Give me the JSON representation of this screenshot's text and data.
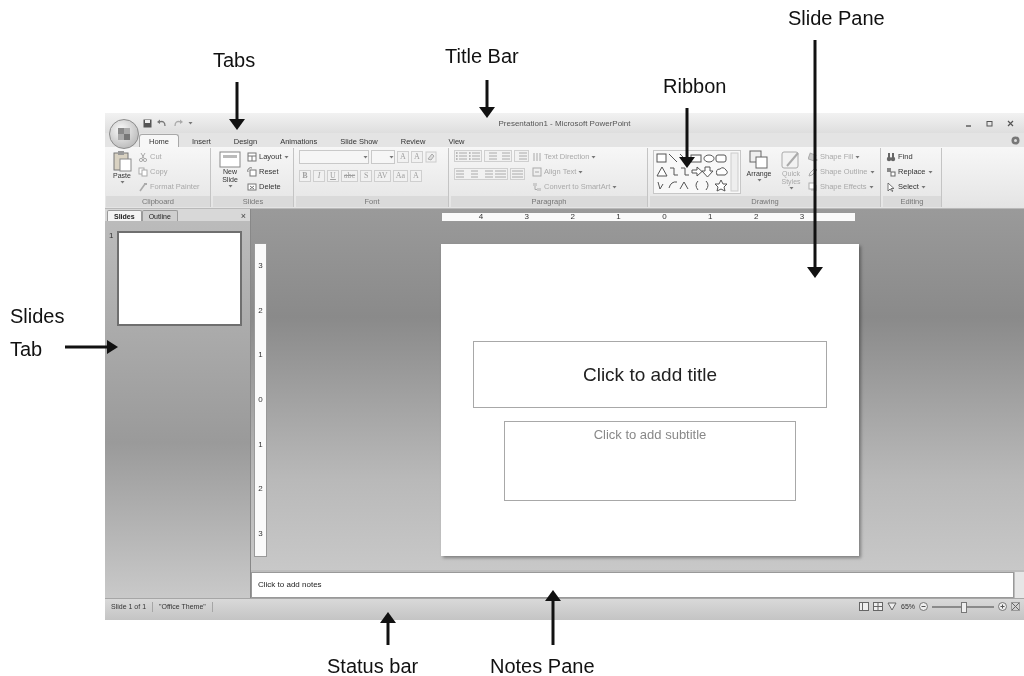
{
  "annotations": [
    {
      "text": "Slide Pane"
    },
    {
      "text": "Tabs"
    },
    {
      "text": "Title Bar"
    },
    {
      "text": "Ribbon"
    },
    {
      "text": "Slides Tab"
    },
    {
      "text": "Status bar"
    },
    {
      "text": "Notes Pane"
    }
  ],
  "title_bar": {
    "title": "Presentation1 - Microsoft PowerPoint"
  },
  "tabs": [
    {
      "label": "Home",
      "selected": true
    },
    {
      "label": "Insert",
      "selected": false
    },
    {
      "label": "Design",
      "selected": false
    },
    {
      "label": "Animations",
      "selected": false
    },
    {
      "label": "Slide Show",
      "selected": false
    },
    {
      "label": "Review",
      "selected": false
    },
    {
      "label": "View",
      "selected": false
    }
  ],
  "ribbon": {
    "groups": [
      {
        "kind": "clipboard",
        "name": "Clipboard",
        "commands": [
          {
            "label": "Paste",
            "disabled": false,
            "dropdown": true
          },
          {
            "label": "Cut",
            "disabled": true,
            "dropdown": false
          },
          {
            "label": "Copy",
            "disabled": true,
            "dropdown": false
          },
          {
            "label": "Format Painter",
            "disabled": true,
            "dropdown": false
          }
        ]
      },
      {
        "kind": "slides",
        "name": "Slides",
        "commands": [
          {
            "label": "New Slide",
            "disabled": false,
            "dropdown": true
          },
          {
            "label": "Layout",
            "disabled": false,
            "dropdown": true
          },
          {
            "label": "Reset",
            "disabled": false,
            "dropdown": false
          },
          {
            "label": "Delete",
            "disabled": false,
            "dropdown": false
          }
        ]
      },
      {
        "kind": "font",
        "name": "Font",
        "commands": [
          {
            "label": "A",
            "disabled": true
          },
          {
            "label": "A",
            "disabled": true
          },
          {
            "label": "B",
            "disabled": true
          },
          {
            "label": "I",
            "disabled": true
          },
          {
            "label": "U",
            "disabled": true
          },
          {
            "label": "abc",
            "disabled": true
          },
          {
            "label": "S",
            "disabled": true
          },
          {
            "label": "AV",
            "disabled": true
          },
          {
            "label": "Aa",
            "disabled": true
          },
          {
            "label": "A",
            "disabled": true
          }
        ]
      },
      {
        "kind": "paragraph",
        "name": "Paragraph",
        "commands": [
          {
            "label": "Text Direction",
            "disabled": true,
            "dropdown": true
          },
          {
            "label": "Align Text",
            "disabled": true,
            "dropdown": true
          },
          {
            "label": "Convert to SmartArt",
            "disabled": true,
            "dropdown": true
          }
        ]
      },
      {
        "kind": "drawing",
        "name": "Drawing",
        "commands": [
          {
            "label": "Arrange",
            "disabled": false,
            "dropdown": true
          },
          {
            "label": "Quick Styles",
            "disabled": true,
            "dropdown": true
          },
          {
            "label": "Shape Fill",
            "disabled": true,
            "dropdown": true
          },
          {
            "label": "Shape Outline",
            "disabled": true,
            "dropdown": true
          },
          {
            "label": "Shape Effects",
            "disabled": true,
            "dropdown": true
          }
        ]
      },
      {
        "kind": "editing",
        "name": "Editing",
        "commands": [
          {
            "label": "Find",
            "disabled": false,
            "dropdown": false
          },
          {
            "label": "Replace",
            "disabled": false,
            "dropdown": true
          },
          {
            "label": "Select",
            "disabled": false,
            "dropdown": true
          }
        ]
      }
    ]
  },
  "slides_panel": {
    "tabs": [
      {
        "label": "Slides",
        "selected": true
      },
      {
        "label": "Outline",
        "selected": false
      }
    ],
    "close": "×",
    "thumbnails": [
      {
        "number": "1",
        "selected": true
      }
    ]
  },
  "horizontal_ruler": {
    "labels": [
      "4",
      "3",
      "2",
      "1",
      "0",
      "1",
      "2",
      "3"
    ]
  },
  "vertical_ruler": {
    "labels": [
      "3",
      "2",
      "1",
      "0",
      "1",
      "2",
      "3"
    ]
  },
  "slide": {
    "title_placeholder": "Click to add title",
    "subtitle_placeholder": "Click to add subtitle"
  },
  "notes": {
    "placeholder": "Click to add notes"
  },
  "status_bar": {
    "slide_info": "Slide 1 of 1",
    "theme": "\"Office Theme\"",
    "zoom": "65%",
    "zoom_slider": {
      "level": 0.5
    }
  }
}
